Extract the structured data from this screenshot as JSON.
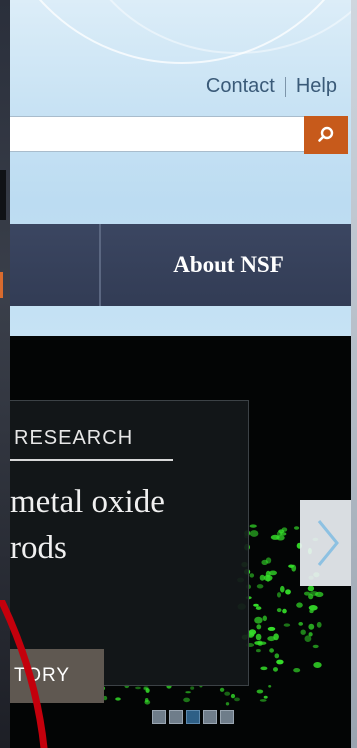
{
  "utility_nav": {
    "contact": "Contact",
    "help": "Help"
  },
  "search": {
    "placeholder": "",
    "value": ""
  },
  "nav": {
    "about": "About NSF"
  },
  "hero": {
    "kicker": "RESEARCH",
    "title_line1": "metal oxide",
    "title_line2": "rods",
    "button_label": "TORY",
    "slide_count": 5,
    "active_slide": 3
  },
  "colors": {
    "accent_orange": "#c75a1b",
    "nav_navy": "#343e57",
    "annotation_red": "#c4000c",
    "glow_green": "#35e02a"
  },
  "icons": {
    "search": "search-icon",
    "next": "chevron-right-icon"
  }
}
